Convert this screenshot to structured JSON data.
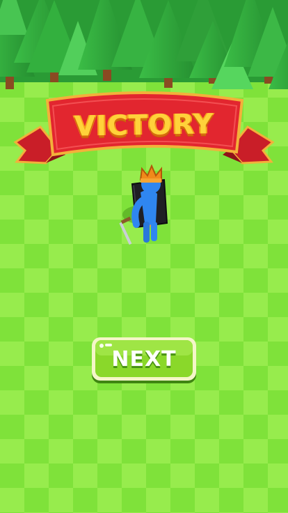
{
  "screen": {
    "banner": {
      "title": "VICTORY",
      "ribbon_color": "#e2262f",
      "border_color": "#f3b13a",
      "text_color": "#ffd23a"
    },
    "next_button": {
      "label": "NEXT",
      "color": "#8ad82a",
      "border_color": "#f4f6c8"
    },
    "character": {
      "body_color": "#2f86f0",
      "crown_color": "#f08a1a",
      "cape_color": "#1f1f24"
    },
    "scene": {
      "grass_light": "#94ec4b",
      "grass_dark": "#7fe23a",
      "tree_color": "#2fa83a",
      "sky_color": "#bfe7ff"
    }
  }
}
